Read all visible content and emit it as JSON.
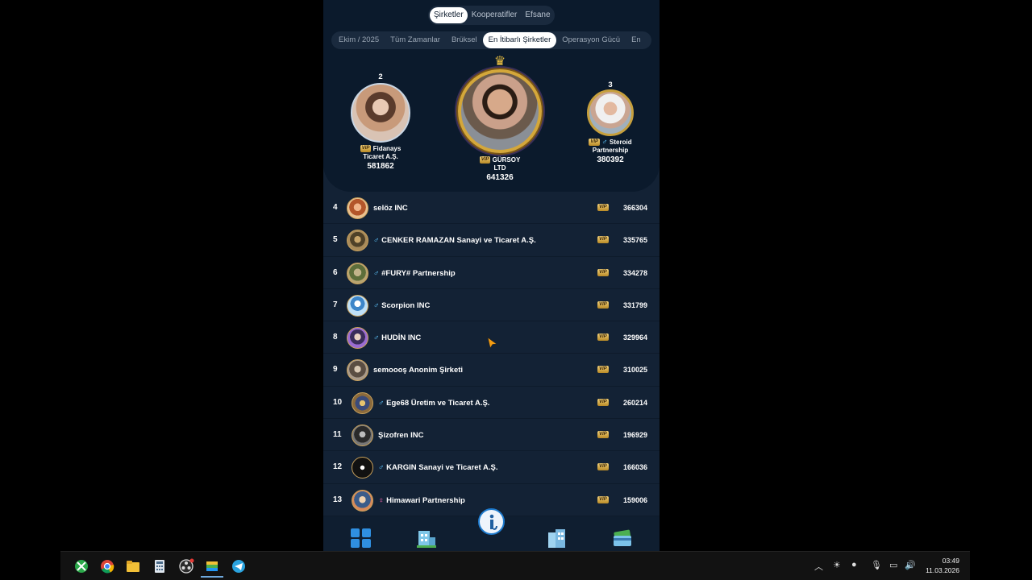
{
  "tabs": {
    "main": [
      "Şirketler",
      "Kooperatifler",
      "Efsane"
    ],
    "active_main": "Şirketler"
  },
  "filters": [
    "Ekim / 2025",
    "Tüm Zamanlar",
    "Brüksel",
    "En İtibarlı Şirketler",
    "Operasyon Gücü",
    "En"
  ],
  "vip_label": "VIP",
  "podium": {
    "first": {
      "rank": "1",
      "name_line1": "GÜRSOY",
      "name_line2": "LTD",
      "score": "641326"
    },
    "second": {
      "rank": "2",
      "name_line1": "Fidanays",
      "name_line2": "Ticaret A.Ş.",
      "score": "581862"
    },
    "third": {
      "rank": "3",
      "name_line1": "Steroid",
      "name_line2": "Partnership",
      "score": "380392"
    }
  },
  "rows": [
    {
      "rank": "4",
      "name": "selöz INC",
      "gender": "",
      "score": "366304"
    },
    {
      "rank": "5",
      "name": "CENKER RAMAZAN Sanayi ve Ticaret A.Ş.",
      "gender": "male",
      "score": "335765"
    },
    {
      "rank": "6",
      "name": "#FURY# Partnership",
      "gender": "male",
      "score": "334278"
    },
    {
      "rank": "7",
      "name": "Scorpion INC",
      "gender": "male",
      "score": "331799"
    },
    {
      "rank": "8",
      "name": "HUDİN INC",
      "gender": "male",
      "score": "329964"
    },
    {
      "rank": "9",
      "name": "semoooş Anonim Şirketi",
      "gender": "",
      "score": "310025"
    },
    {
      "rank": "10",
      "name": "Ege68 Üretim ve Ticaret A.Ş.",
      "gender": "male",
      "score": "260214"
    },
    {
      "rank": "11",
      "name": "Şizofren INC",
      "gender": "",
      "score": "196929"
    },
    {
      "rank": "12",
      "name": "KARGIN Sanayi ve Ticaret A.Ş.",
      "gender": "male",
      "score": "166036"
    },
    {
      "rank": "13",
      "name": "Himawari Partnership",
      "gender": "female",
      "score": "159006"
    }
  ],
  "gender_symbols": {
    "male": "♂",
    "female": "♀"
  },
  "bottom_nav": [
    "dashboard-icon",
    "buildings-icon",
    "logo-icon",
    "office-icon",
    "cards-icon"
  ],
  "taskbar": {
    "time": "03:49",
    "date": "11.03.2026"
  },
  "colors": {
    "background": "#132235",
    "header": "#0b1a2c",
    "gold": "#d4a73a",
    "male": "#5ec6ff",
    "female": "#ff66b3"
  }
}
